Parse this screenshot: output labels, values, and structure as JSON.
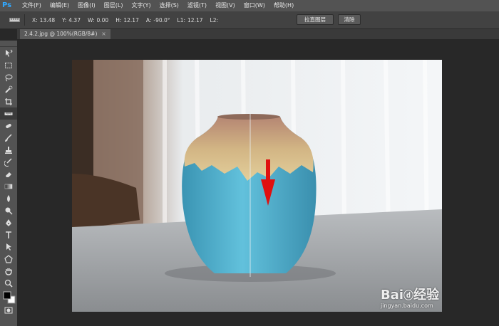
{
  "app": {
    "logo": "Ps"
  },
  "menu": [
    "文件(F)",
    "编辑(E)",
    "图像(I)",
    "图层(L)",
    "文字(Y)",
    "选择(S)",
    "滤镜(T)",
    "视图(V)",
    "窗口(W)",
    "帮助(H)"
  ],
  "options": {
    "x": {
      "label": "X:",
      "value": "13.48"
    },
    "y": {
      "label": "Y:",
      "value": "4.37"
    },
    "w": {
      "label": "W:",
      "value": "0.00"
    },
    "h": {
      "label": "H:",
      "value": "12.17"
    },
    "a": {
      "label": "A:",
      "value": "-90.0°"
    },
    "l1": {
      "label": "L1:",
      "value": "12.17"
    },
    "l2": {
      "label": "L2:",
      "value": ""
    },
    "straighten_button": "拉直图层",
    "clear_button": "清除"
  },
  "document": {
    "tab_label": "2.4.2.jpg @ 100%(RGB/8#)",
    "close_symbol": "×"
  },
  "watermark": {
    "line1": "Bai",
    "line2": "经验",
    "url": "jingyan.baidu.com"
  },
  "tools": [
    "move-icon",
    "marquee-icon",
    "lasso-icon",
    "quick-select-icon",
    "crop-icon",
    "ruler-icon",
    "healing-icon",
    "brush-icon",
    "stamp-icon",
    "history-brush-icon",
    "eraser-icon",
    "gradient-icon",
    "blur-icon",
    "dodge-icon",
    "pen-icon",
    "type-icon",
    "path-select-icon",
    "shape-icon",
    "hand-icon",
    "zoom-icon"
  ],
  "colors": {
    "accent": "#31a8ff",
    "arrow": "#e01010",
    "foreground": "#000000",
    "background": "#ffffff"
  }
}
